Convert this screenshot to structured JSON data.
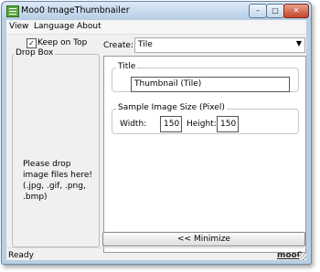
{
  "window": {
    "title": "Moo0 ImageThumbnailer"
  },
  "titlebar_buttons": {
    "minimize": "–",
    "maximize": "□",
    "close": "✕"
  },
  "menu": [
    "View",
    "Language",
    "About"
  ],
  "keep_on_top": {
    "label": "Keep on Top",
    "checked": true,
    "mark": "✓"
  },
  "dropbox": {
    "legend": "Drop Box",
    "message": "Please drop\nimage files here!\n(.jpg, .gif, .png,\n.bmp)"
  },
  "create": {
    "label": "Create:",
    "value": "Tile",
    "arrow": "▼"
  },
  "title_group": {
    "legend": "Title",
    "value": "Thumbnail (Tile)"
  },
  "size_group": {
    "legend": "Sample Image Size (Pixel)",
    "width_label": "Width:",
    "width_value": "150",
    "height_label": "Height:",
    "height_value": "150"
  },
  "minimize_button": "<< Minimize",
  "status": {
    "text": "Ready",
    "link": "moo0"
  },
  "icons": {
    "app": "app-icon",
    "dropdown": "chevron-down-icon",
    "check": "check-icon",
    "grip": "resize-grip-icon"
  },
  "colors": {
    "titlebar": "#b6cde4",
    "close_button": "#c5442a",
    "app_icon": "#5aa83a"
  }
}
